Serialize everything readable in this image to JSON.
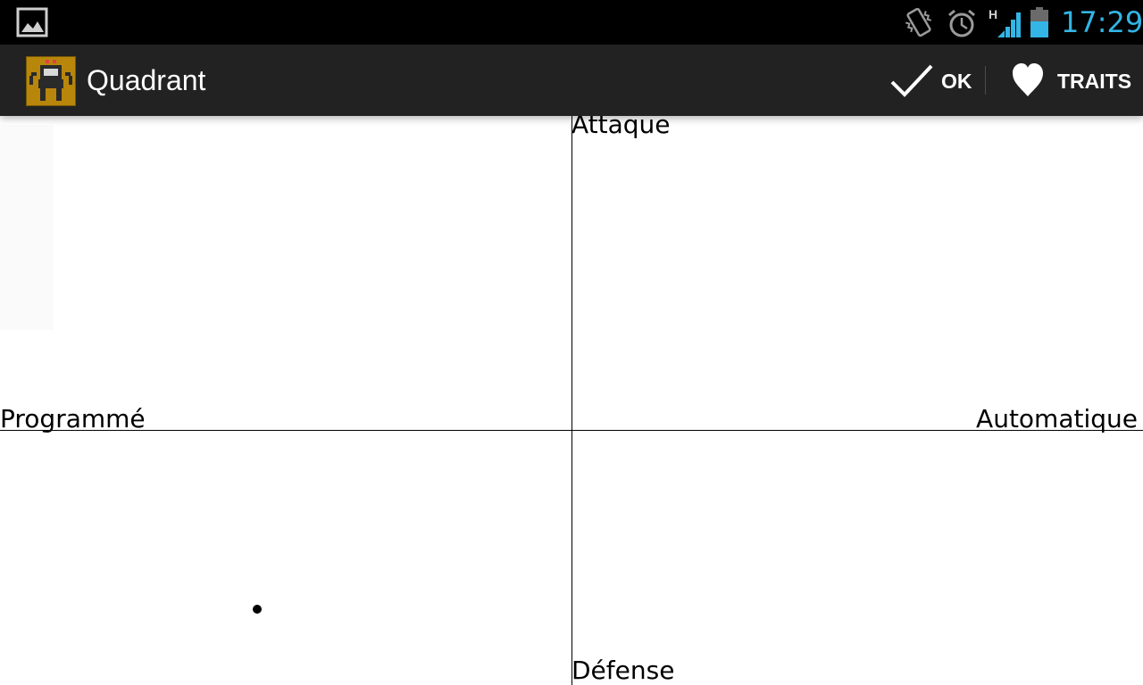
{
  "status_bar": {
    "time": "17:29",
    "time_color": "#33b5e5",
    "icons": [
      "gallery-notification-icon",
      "vibrate-icon",
      "alarm-icon",
      "hspa-signal-icon",
      "battery-icon"
    ],
    "network_type": "H"
  },
  "action_bar": {
    "title": "Quadrant",
    "app_icon": "robot-app-icon",
    "actions": [
      {
        "label": "OK",
        "icon": "check-icon"
      },
      {
        "label": "TRAITS",
        "icon": "heart-icon"
      }
    ]
  },
  "quadrant": {
    "axes": {
      "top": "Attaque",
      "bottom": "Défense",
      "left": "Programmé",
      "right": "Automatique"
    },
    "point": {
      "x": -0.55,
      "y": -0.57
    }
  },
  "colors": {
    "status_bar_bg": "#000000",
    "action_bar_bg": "#222222",
    "accent": "#33b5e5",
    "app_icon_gold": "#b8860b"
  }
}
